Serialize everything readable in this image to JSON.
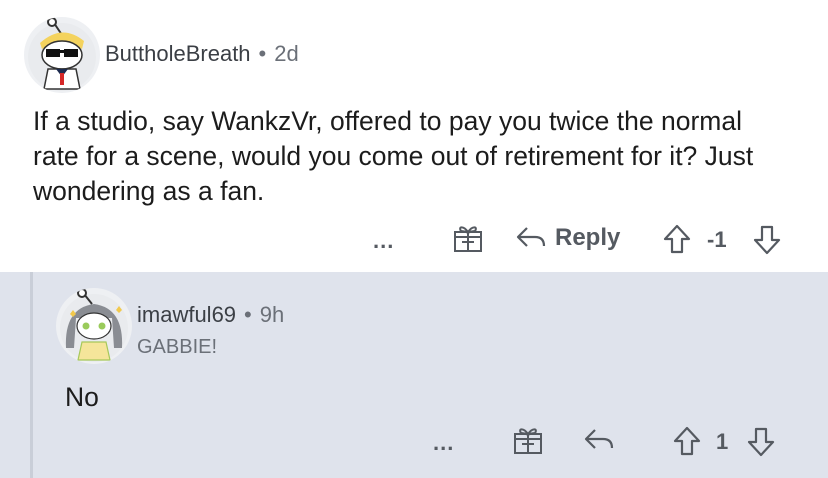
{
  "comment": {
    "username": "ButtholeBreath",
    "separator": "•",
    "time": "2d",
    "body": "If a studio, say WankzVr, offered to pay you twice the normal rate for a scene, would you come out of retirement for it? Just wondering as a fan.",
    "actions": {
      "more": "...",
      "reply_label": "Reply",
      "vote_count": "-1"
    }
  },
  "reply": {
    "username": "imawful69",
    "separator": "•",
    "time": "9h",
    "flair": "GABBIE!",
    "body": "No",
    "actions": {
      "more": "...",
      "vote_count": "1"
    }
  },
  "colors": {
    "reply_background": "#dfe3ec",
    "text": "#1c1c1c",
    "meta": "#6b7078"
  }
}
